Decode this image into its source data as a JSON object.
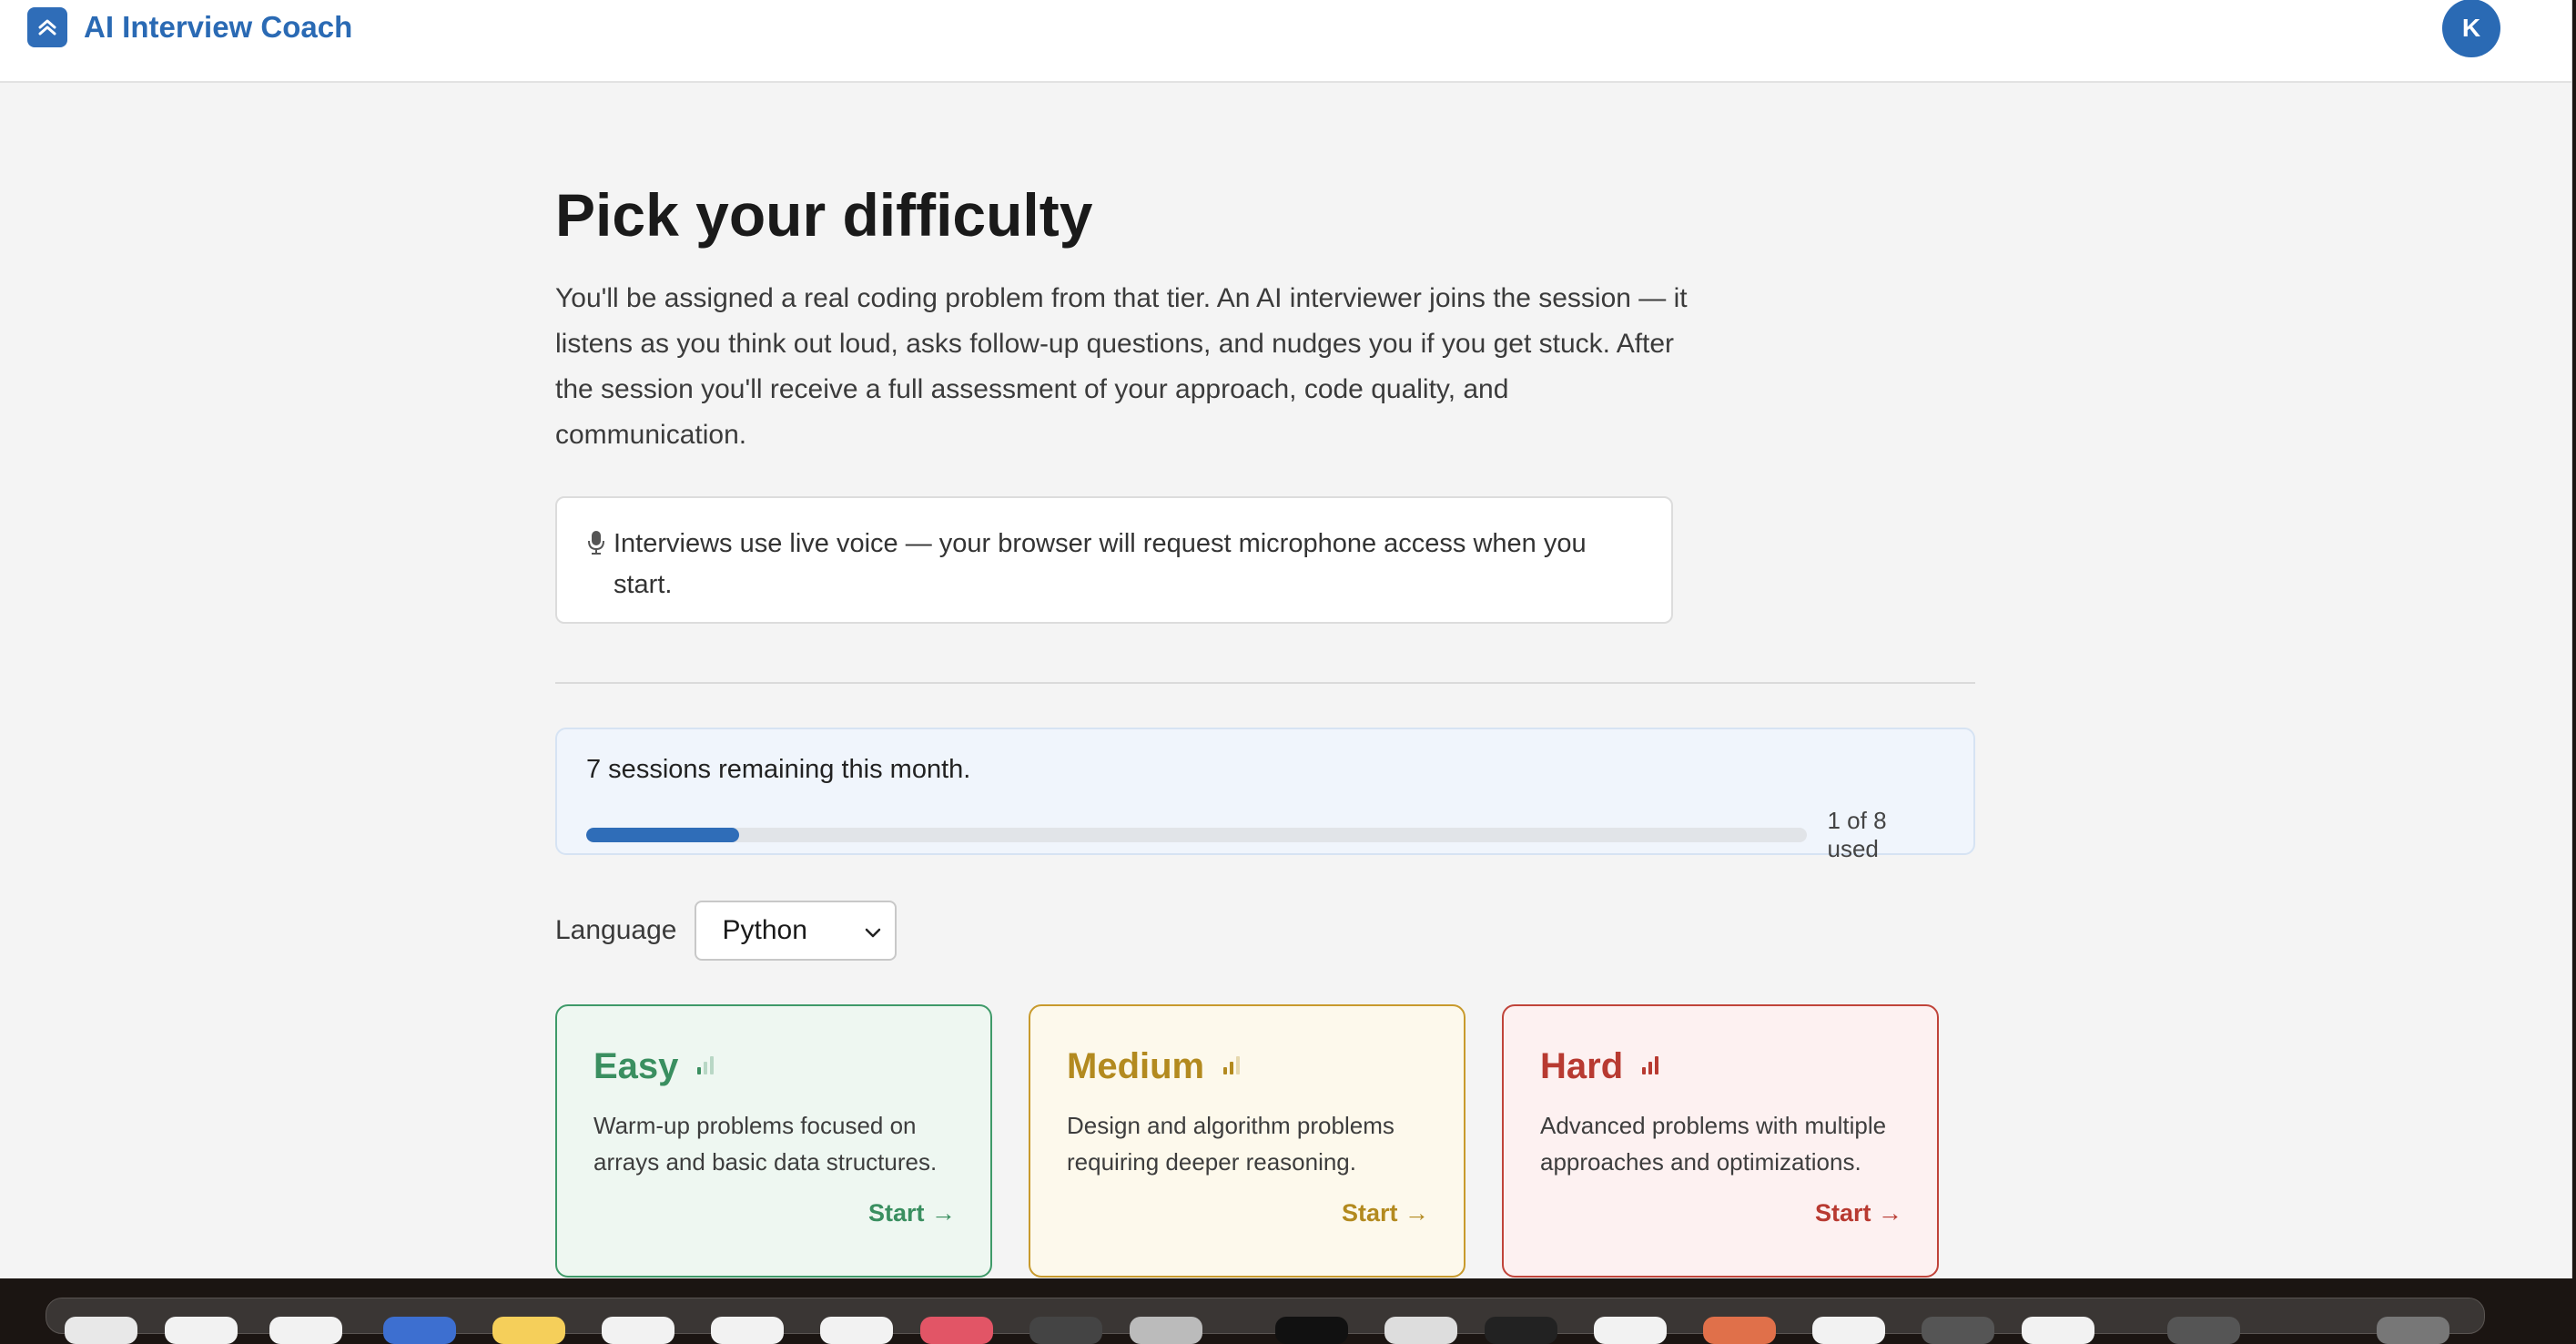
{
  "header": {
    "app_name": "AI Interview Coach",
    "logo_icon": "chevron-up-icon",
    "avatar_initial": "K",
    "accent_color": "#2a6ab4"
  },
  "main": {
    "title": "Pick your difficulty",
    "intro": "You'll be assigned a real coding problem from that tier. An AI interviewer joins the session — it listens as you think out loud, asks follow-up questions, and nudges you if you get stuck. After the session you'll receive a full assessment of your approach, code quality, and communication.",
    "notice": {
      "icon": "microphone-icon",
      "text": "Interviews use live voice — your browser will request microphone access when you start."
    },
    "quota": {
      "message": "7 sessions remaining this month.",
      "used_label": "1 of 8 used",
      "used_fraction": 0.125
    },
    "language": {
      "label": "Language",
      "selected": "Python"
    },
    "cards": [
      {
        "key": "easy",
        "title": "Easy",
        "description": "Warm-up problems focused on arrays and basic data structures.",
        "cta": "Start →",
        "color": "#3a8f60",
        "bars_active": 1
      },
      {
        "key": "medium",
        "title": "Medium",
        "description": "Design and algorithm problems requiring deeper reasoning.",
        "cta": "Start →",
        "color": "#b38a1f",
        "bars_active": 2
      },
      {
        "key": "hard",
        "title": "Hard",
        "description": "Advanced problems with multiple approaches and optimizations.",
        "cta": "Start →",
        "color": "#b83a31",
        "bars_active": 3
      }
    ]
  }
}
